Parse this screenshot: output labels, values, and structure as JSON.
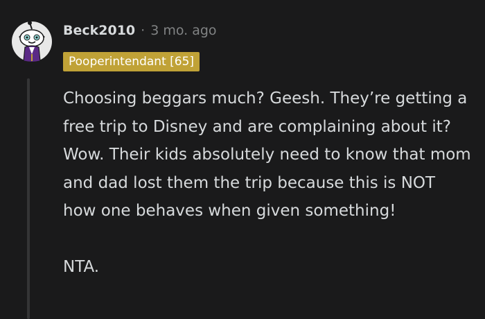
{
  "comment": {
    "username": "Beck2010",
    "separator": "·",
    "timestamp": "3 mo. ago",
    "flair": "Pooperintendant [65]",
    "paragraphs": [
      "Choosing beggars much? Geesh. They’re getting a free trip to Disney and are complaining about it? Wow. Their kids absolutely need to know that mom and dad lost them the trip because this is NOT how one behaves when given something!",
      "NTA."
    ],
    "avatar_icon": "snoo-avatar-icon"
  },
  "colors": {
    "background": "#1a1a1b",
    "text": "#d7dadc",
    "muted": "#818384",
    "flair_bg": "#c0a237",
    "thread_line": "#343536"
  }
}
